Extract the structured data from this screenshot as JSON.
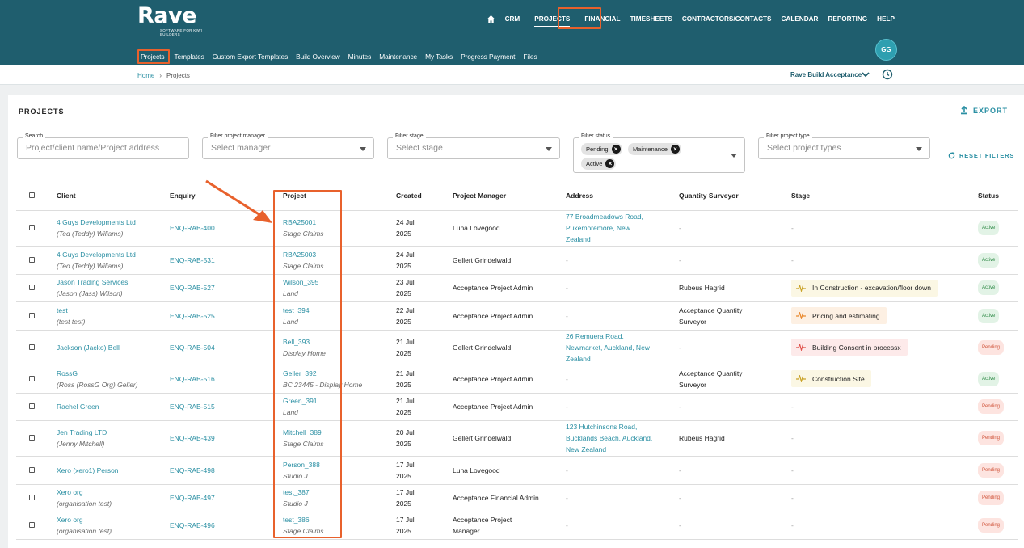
{
  "header": {
    "brand": "Rave",
    "tagline": "SOFTWARE FOR KIWI BUILDERS",
    "nav": [
      "CRM",
      "PROJECTS",
      "FINANCIAL",
      "TIMESHEETS",
      "CONTRACTORS/CONTACTS",
      "CALENDAR",
      "REPORTING",
      "HELP"
    ],
    "subnav": [
      "Projects",
      "Templates",
      "Custom Export Templates",
      "Build Overview",
      "Minutes",
      "Maintenance",
      "My Tasks",
      "Progress Payment",
      "Files"
    ],
    "avatar": "GG"
  },
  "breadcrumb": {
    "home": "Home",
    "current": "Projects"
  },
  "account": "Rave Build Acceptance",
  "page": {
    "title": "PROJECTS",
    "export": "EXPORT",
    "reset": "RESET FILTERS"
  },
  "filters": {
    "search": {
      "label": "Search",
      "placeholder": "Project/client name/Project address"
    },
    "manager": {
      "label": "Filter project manager",
      "placeholder": "Select manager"
    },
    "stage": {
      "label": "Filter stage",
      "placeholder": "Select stage"
    },
    "status": {
      "label": "Filter status",
      "chips": [
        "Pending",
        "Maintenance",
        "Active"
      ]
    },
    "type": {
      "label": "Filter project type",
      "placeholder": "Select project types"
    }
  },
  "table": {
    "headers": [
      "Client",
      "Enquiry",
      "Project",
      "Created",
      "Project Manager",
      "Address",
      "Quantity Surveyor",
      "Stage",
      "Status"
    ],
    "rows": [
      {
        "client": "4 Guys Developments Ltd",
        "client_sub": "(Ted (Teddy) Wiliams)",
        "enquiry": "ENQ-RAB-400",
        "project": "RBA25001",
        "project_sub": "Stage Claims",
        "created1": "24 Jul",
        "created2": "2025",
        "manager": [
          "Luna Lovegood"
        ],
        "address": [
          "77 Broadmeadows Road,",
          "Pukemoremore, New",
          "Zealand"
        ],
        "qs": [],
        "stage": "",
        "status": "Active"
      },
      {
        "client": "4 Guys Developments Ltd",
        "client_sub": "(Ted (Teddy) Wiliams)",
        "enquiry": "ENQ-RAB-531",
        "project": "RBA25003",
        "project_sub": "Stage Claims",
        "created1": "24 Jul",
        "created2": "2025",
        "manager": [
          "Gellert Grindelwald"
        ],
        "address": [],
        "qs": [],
        "stage": "",
        "status": "Active"
      },
      {
        "client": "Jason Trading Services",
        "client_sub": "(Jason (Jass) Wilson)",
        "enquiry": "ENQ-RAB-527",
        "project": "Wilson_395",
        "project_sub": "Land",
        "created1": "23 Jul",
        "created2": "2025",
        "manager": [
          "Acceptance Project Admin"
        ],
        "address": [],
        "qs": [
          "Rubeus Hagrid"
        ],
        "stage": "In Construction - excavation/floor down",
        "stage_color": "#c9a227",
        "stage_bg": "y",
        "status": "Active"
      },
      {
        "client": "test",
        "client_sub": "(test test)",
        "enquiry": "ENQ-RAB-525",
        "project": "test_394",
        "project_sub": "Land",
        "created1": "22 Jul",
        "created2": "2025",
        "manager": [
          "Acceptance Project Admin"
        ],
        "address": [],
        "qs": [
          "Acceptance Quantity",
          "Surveyor"
        ],
        "stage": "Pricing and estimating",
        "stage_color": "#e9892f",
        "stage_bg": "o",
        "status": "Active"
      },
      {
        "client": "Jackson (Jacko) Bell",
        "client_sub": "",
        "enquiry": "ENQ-RAB-504",
        "project": "Bell_393",
        "project_sub": "Display Home",
        "created1": "21 Jul",
        "created2": "2025",
        "manager": [
          "Gellert Grindelwald"
        ],
        "address": [
          "26 Remuera Road,",
          "Newmarket, Auckland, New",
          "Zealand"
        ],
        "qs": [],
        "stage": "Building Consent in processx",
        "stage_color": "#e0524b",
        "stage_bg": "r",
        "status": "Pending"
      },
      {
        "client": "RossG",
        "client_sub": "(Ross (RossG Org) Geller)",
        "enquiry": "ENQ-RAB-516",
        "project": "Geller_392",
        "project_sub": "BC 23445 - Display Home",
        "created1": "21 Jul",
        "created2": "2025",
        "manager": [
          "Acceptance Project Admin"
        ],
        "address": [],
        "qs": [
          "Acceptance Quantity",
          "Surveyor"
        ],
        "stage": "Construction Site",
        "stage_color": "#c9a227",
        "stage_bg": "y",
        "status": "Active"
      },
      {
        "client": "Rachel Green",
        "client_sub": "",
        "enquiry": "ENQ-RAB-515",
        "project": "Green_391",
        "project_sub": "Land",
        "created1": "21 Jul",
        "created2": "2025",
        "manager": [
          "Acceptance Project Admin"
        ],
        "address": [],
        "qs": [],
        "stage": "",
        "status": "Pending"
      },
      {
        "client": "Jen Trading LTD",
        "client_sub": "(Jenny Mitchell)",
        "enquiry": "ENQ-RAB-439",
        "project": "Mitchell_389",
        "project_sub": "Stage Claims",
        "created1": "20 Jul",
        "created2": "2025",
        "manager": [
          "Gellert Grindelwald"
        ],
        "address": [
          "123 Hutchinsons Road,",
          "Bucklands Beach, Auckland,",
          "New Zealand"
        ],
        "qs": [
          "Rubeus Hagrid"
        ],
        "stage": "",
        "status": "Pending"
      },
      {
        "client": "Xero (xero1) Person",
        "client_sub": "",
        "enquiry": "ENQ-RAB-498",
        "project": "Person_388",
        "project_sub": "Studio J",
        "created1": "17 Jul",
        "created2": "2025",
        "manager": [
          "Luna Lovegood"
        ],
        "address": [],
        "qs": [],
        "stage": "",
        "status": "Pending"
      },
      {
        "client": "Xero org",
        "client_sub": "(organisation test)",
        "enquiry": "ENQ-RAB-497",
        "project": "test_387",
        "project_sub": "Studio J",
        "created1": "17 Jul",
        "created2": "2025",
        "manager": [
          "Acceptance Financial Admin"
        ],
        "address": [],
        "qs": [],
        "stage": "",
        "status": "Pending"
      },
      {
        "client": "Xero org",
        "client_sub": "(organisation test)",
        "enquiry": "ENQ-RAB-496",
        "project": "test_386",
        "project_sub": "Stage Claims",
        "created1": "17 Jul",
        "created2": "2025",
        "manager": [
          "Acceptance Project",
          "Manager"
        ],
        "address": [],
        "qs": [],
        "stage": "",
        "status": "Pending"
      }
    ]
  },
  "placeholders": {
    "dash": "-"
  },
  "colors": {
    "header": "#1f5e6e",
    "accent": "#2a8fa3",
    "highlight": "#e8612c"
  }
}
